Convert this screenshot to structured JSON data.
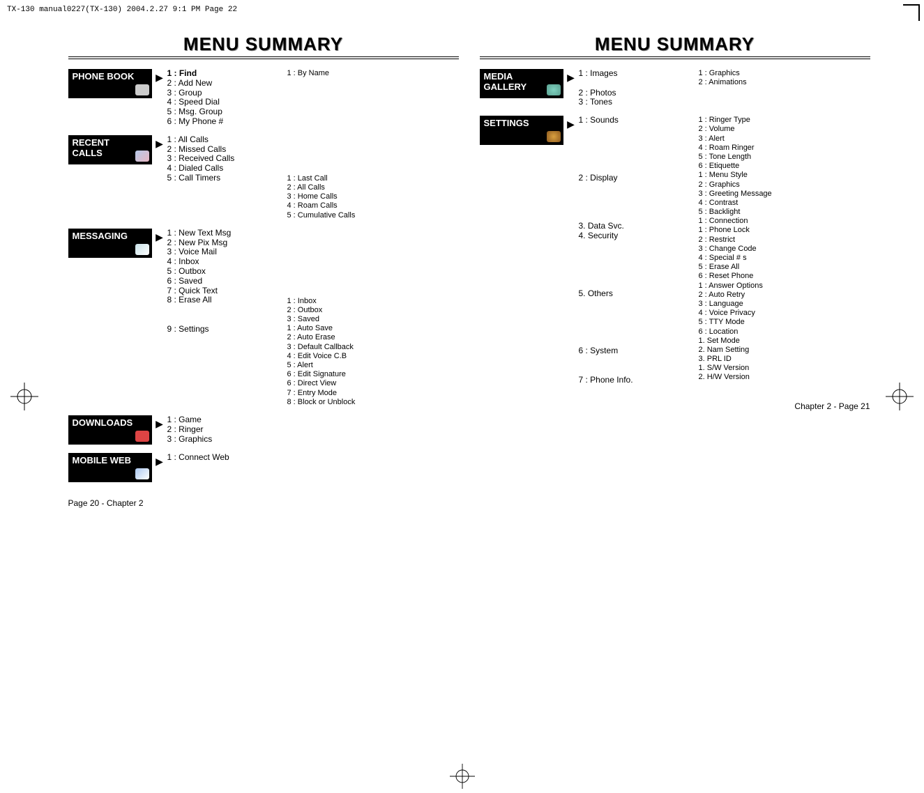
{
  "code_header": "TX-130 manual0227(TX-130)  2004.2.27  9:1 PM  Page 22",
  "title_left": "MENU SUMMARY",
  "title_right": "MENU SUMMARY",
  "left": {
    "phonebook": {
      "label": "PHONE BOOK",
      "items": [
        "1 : Find",
        "2 : Add New",
        "3 : Group",
        "4 : Speed Dial",
        "5 : Msg. Group",
        "6 : My Phone #"
      ],
      "sub_find": "1 : By Name"
    },
    "recent": {
      "label": "RECENT\nCALLS",
      "items": [
        "1 : All Calls",
        "2 : Missed Calls",
        "3 : Received Calls",
        "4 : Dialed Calls",
        "5 : Call Timers"
      ],
      "timers_sub": [
        "1 : Last Call",
        "2 : All Calls",
        "3 : Home Calls",
        "4 : Roam Calls",
        "5 : Cumulative Calls"
      ]
    },
    "messaging": {
      "label": "MESSAGING",
      "items": [
        "1 : New Text Msg",
        "2 : New Pix Msg",
        "3 : Voice Mail",
        "4 : Inbox",
        "5 : Outbox",
        "6 : Saved",
        "7 : Quick Text",
        "8 : Erase All",
        "",
        "9 : Settings"
      ],
      "erase_sub": [
        "1 : Inbox",
        "2 : Outbox",
        "3 : Saved"
      ],
      "settings_sub": [
        "1 : Auto Save",
        "2 : Auto Erase",
        "3 : Default Callback",
        "4 : Edit Voice C.B",
        "5 : Alert",
        "6 : Edit Signature",
        "6 : Direct View",
        "7 : Entry Mode",
        "8 : Block or Unblock"
      ]
    },
    "downloads": {
      "label": "DOWNLOADS",
      "items": [
        "1 : Game",
        "2 : Ringer",
        "3 : Graphics"
      ]
    },
    "mobileweb": {
      "label": "MOBILE WEB",
      "items": [
        "1 : Connect Web"
      ]
    },
    "footer": "Page 20 - Chapter 2"
  },
  "right": {
    "media": {
      "label": "MEDIA\nGALLERY",
      "items": [
        "1 : Images",
        "",
        "2 : Photos",
        "3 : Tones"
      ],
      "images_sub": [
        "1 : Graphics",
        "2 : Animations"
      ]
    },
    "settings": {
      "label": "SETTINGS",
      "items": [
        "1 : Sounds",
        "",
        "",
        "",
        "",
        "",
        "2 : Display",
        "",
        "",
        "",
        "",
        "3. Data Svc.",
        "4. Security",
        "",
        "",
        "",
        "",
        "",
        "5. Others",
        "",
        "",
        "",
        "",
        "",
        "6 : System",
        "",
        "",
        "7 : Phone Info."
      ],
      "subs": [
        "1 : Ringer Type",
        "2 : Volume",
        "3 : Alert",
        "4 : Roam Ringer",
        "5 : Tone Length",
        "6 : Etiquette",
        "1 : Menu Style",
        "2 : Graphics",
        "3 : Greeting Message",
        "4 : Contrast",
        "5 : Backlight",
        "1 : Connection",
        "1 : Phone Lock",
        "2 : Restrict",
        "3 : Change Code",
        "4 : Special # s",
        "5 : Erase All",
        "6 : Reset Phone",
        "1 : Answer Options",
        "2 : Auto Retry",
        "3 : Language",
        "4 : Voice Privacy",
        "5 : TTY Mode",
        "6 : Location",
        "1. Set Mode",
        "2. Nam Setting",
        "3. PRL ID",
        "1. S/W Version",
        "2. H/W Version"
      ]
    },
    "footer": "Chapter 2 - Page 21"
  }
}
